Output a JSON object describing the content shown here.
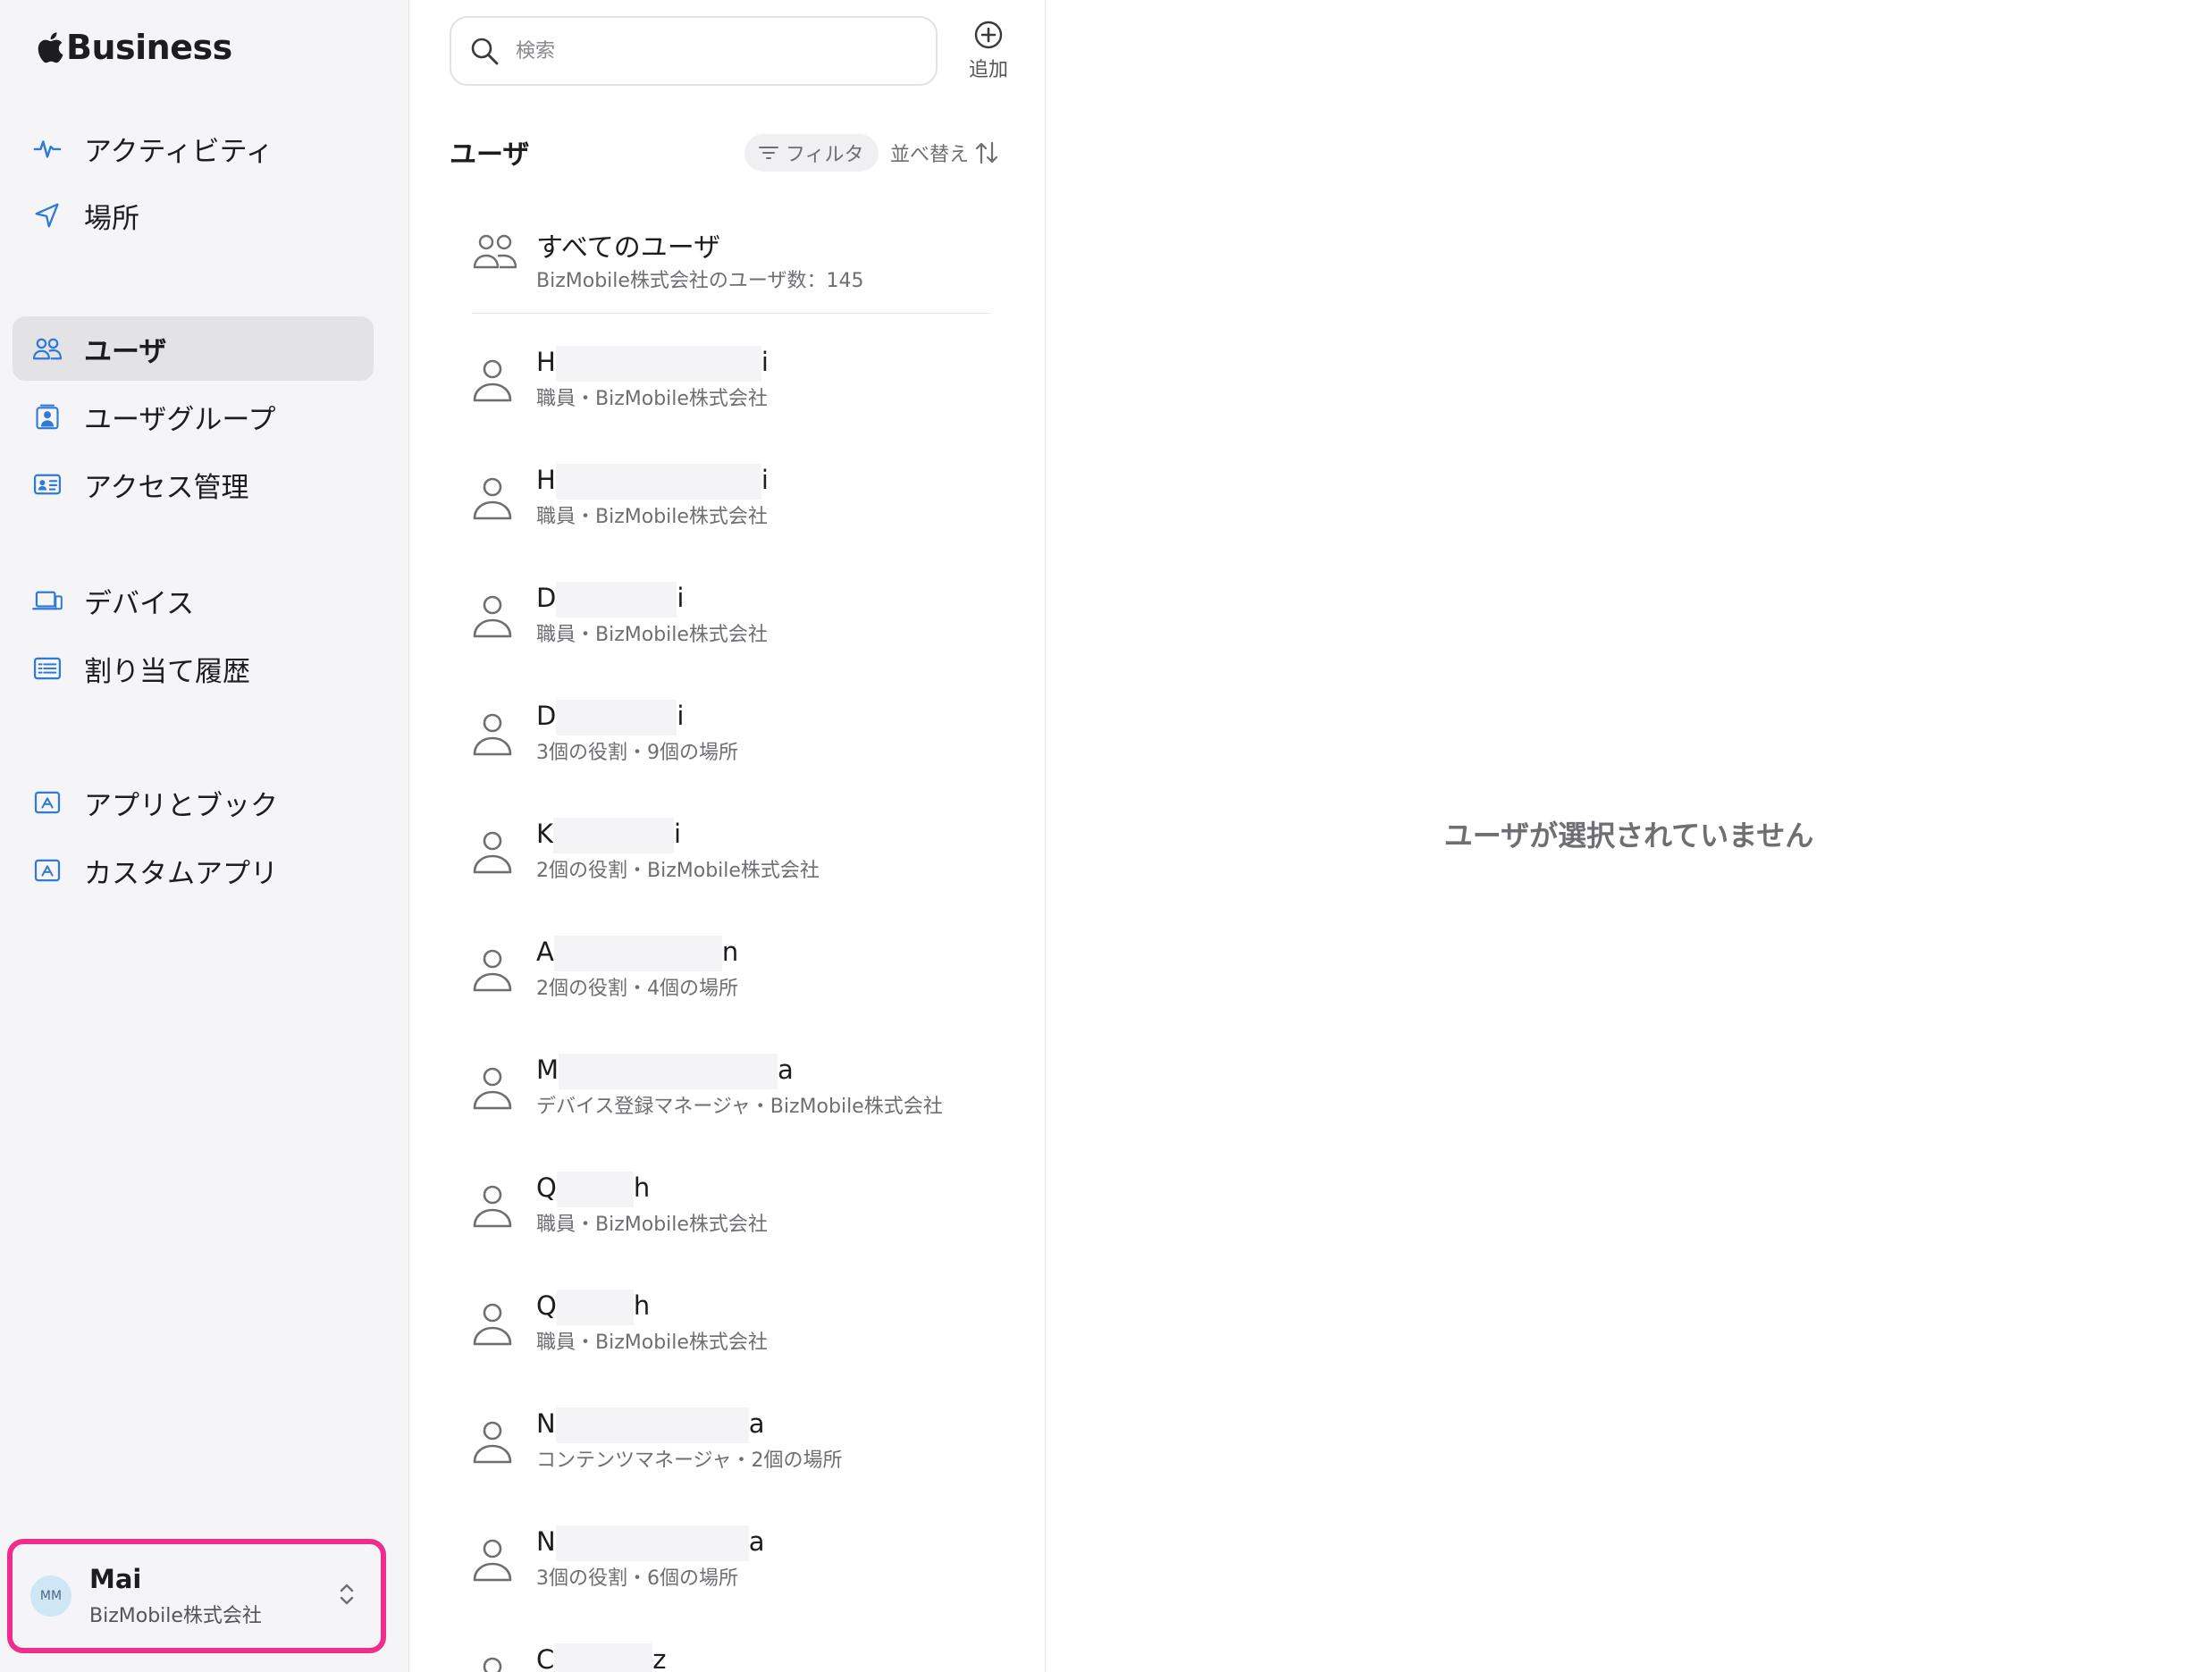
{
  "brand": {
    "name": "Business"
  },
  "sidebar": {
    "items": [
      {
        "label": "アクティビティ",
        "icon": "activity-icon",
        "active": false
      },
      {
        "label": "場所",
        "icon": "location-arrow-icon",
        "active": false
      },
      {
        "label": "ユーザ",
        "icon": "users-icon",
        "active": true
      },
      {
        "label": "ユーザグループ",
        "icon": "user-group-icon",
        "active": false
      },
      {
        "label": "アクセス管理",
        "icon": "id-card-icon",
        "active": false
      },
      {
        "label": "デバイス",
        "icon": "laptop-icon",
        "active": false
      },
      {
        "label": "割り当て履歴",
        "icon": "list-icon",
        "active": false
      },
      {
        "label": "アプリとブック",
        "icon": "app-store-icon",
        "active": false
      },
      {
        "label": "カスタムアプリ",
        "icon": "custom-app-icon",
        "active": false
      }
    ],
    "account": {
      "initials": "MM",
      "name": "Mai",
      "org": "BizMobile株式会社"
    }
  },
  "list": {
    "search_placeholder": "検索",
    "add_label": "追加",
    "title": "ユーザ",
    "filter_label": "フィルタ",
    "sort_label": "並べ替え",
    "all_users": {
      "name": "すべてのユーザ",
      "sub": "BizMobile株式会社のユーザ数：145"
    },
    "users": [
      {
        "first": "H",
        "last": "i",
        "sub": "職員・BizMobile株式会社"
      },
      {
        "first": "H",
        "last": "i",
        "sub": "職員・BizMobile株式会社"
      },
      {
        "first": "D",
        "last": "i",
        "sub": "職員・BizMobile株式会社"
      },
      {
        "first": "D",
        "last": "i",
        "sub": "3個の役割・9個の場所"
      },
      {
        "first": "K",
        "last": "i",
        "sub": "2個の役割・BizMobile株式会社"
      },
      {
        "first": "A",
        "last": "n",
        "sub": "2個の役割・4個の場所"
      },
      {
        "first": "M",
        "last": "a",
        "sub": "デバイス登録マネージャ・BizMobile株式会社"
      },
      {
        "first": "Q",
        "last": "h",
        "sub": "職員・BizMobile株式会社"
      },
      {
        "first": "Q",
        "last": "h",
        "sub": "職員・BizMobile株式会社"
      },
      {
        "first": "N",
        "last": "a",
        "sub": "コンテンツマネージャ・2個の場所"
      },
      {
        "first": "N",
        "last": "a",
        "sub": "3個の役割・6個の場所"
      },
      {
        "first": "C",
        "last": "z",
        "sub": ""
      }
    ]
  },
  "detail": {
    "empty_message": "ユーザが選択されていません"
  },
  "colors": {
    "accent": "#2f7ad9",
    "highlight_border": "#ef2d8f",
    "sidebar_bg": "#f5f5f7"
  }
}
